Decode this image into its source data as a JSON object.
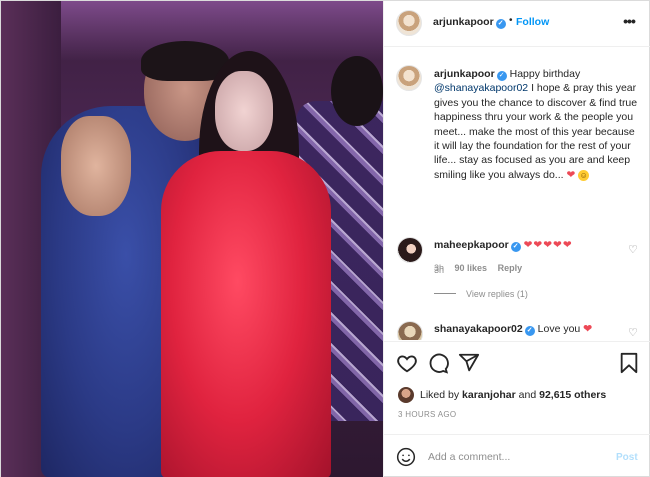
{
  "post": {
    "username": "arjunkapoor",
    "follow_label": "Follow",
    "dot": "•",
    "more_label": "•••"
  },
  "caption": {
    "username": "arjunkapoor",
    "text_before": "Happy birthday",
    "mention": "@shanayakapoor02",
    "text_after": " I hope & pray this year gives you the chance to discover & find true happiness thru your work & the people you meet... make the most of this year because it will lay the foundation for the rest of your life... stay as focused as you are and keep smiling like you always do...",
    "heart": "❤",
    "smile": "☺",
    "time": "3h"
  },
  "comments": [
    {
      "username": "maheepkapoor",
      "text": "❤❤❤❤❤",
      "time": "3h",
      "likes": "90 likes",
      "reply_label": "Reply",
      "view_replies": "View replies (1)"
    },
    {
      "username": "shanayakapoor02",
      "text": "Love you",
      "heart": "❤"
    }
  ],
  "likes": {
    "prefix": "Liked by",
    "liker": "karanjohar",
    "joiner": "and",
    "others": "92,615 others"
  },
  "timestamp": "3 HOURS AGO",
  "add_comment": {
    "placeholder": "Add a comment...",
    "post_label": "Post"
  },
  "icons": {
    "verified": "✓",
    "comment_like": "♡"
  },
  "colors": {
    "link_blue": "#0095f6",
    "verified_blue": "#3897f0",
    "heart_red": "#ed4956",
    "muted": "#8e8e8e",
    "post_disabled": "#b2dffc"
  }
}
